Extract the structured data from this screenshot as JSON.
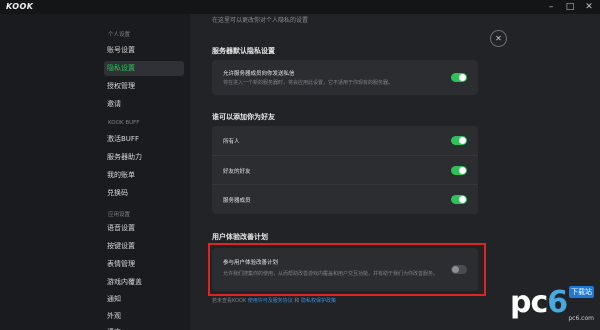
{
  "app": {
    "logo": "KOOK"
  },
  "window_controls": {
    "minimize": "–",
    "maximize": "□",
    "close": "✕"
  },
  "sidebar": {
    "sections": [
      {
        "title": "个人设置",
        "items": [
          "账号设置",
          "隐私设置",
          "授权管理",
          "邀请"
        ]
      },
      {
        "title": "KOOK BUFF",
        "items": [
          "激活BUFF",
          "服务器助力",
          "我的账单",
          "兑换码"
        ]
      },
      {
        "title": "应用设置",
        "items": [
          "语音设置",
          "按键设置",
          "表情管理",
          "游戏内覆盖",
          "通知",
          "外观",
          "语言"
        ]
      }
    ],
    "active": "隐私设置"
  },
  "main": {
    "subtitle": "在这里可以更改你对个人隐私的设置",
    "close_icon": "✕",
    "server_privacy": {
      "title": "服务器默认隐私设置",
      "row_title": "允许服务器成员向你发送私信",
      "row_desc": "将在进入一个新的服务器时，将会应用此设置，它不适用于你现有的服务器。",
      "enabled": true
    },
    "friend_requests": {
      "title": "谁可以添加你为好友",
      "rows": [
        {
          "label": "所有人",
          "enabled": true
        },
        {
          "label": "好友的好友",
          "enabled": true
        },
        {
          "label": "服务器成员",
          "enabled": true
        }
      ]
    },
    "ux_program": {
      "title": "用户体验改善计划",
      "row_title": "参与用户体验改善计划",
      "row_desc": "允许我们搜集你的使用，从而帮助改善游戏内覆盖和用户交互功能，并有助于我们为你改善服务。",
      "enabled": false
    },
    "footer": {
      "prefix": "若未查看KOOK",
      "link1": "使用许可及服务协议",
      "mid": " 和 ",
      "link2": "隐私权保护政策"
    }
  },
  "watermark": {
    "pc": "pc",
    "six": "6",
    "tag": "下载站",
    "url": "pc6.com"
  },
  "colors": {
    "accent": "#2fc15a",
    "link": "#3a8fd9",
    "highlight": "#e02424"
  }
}
